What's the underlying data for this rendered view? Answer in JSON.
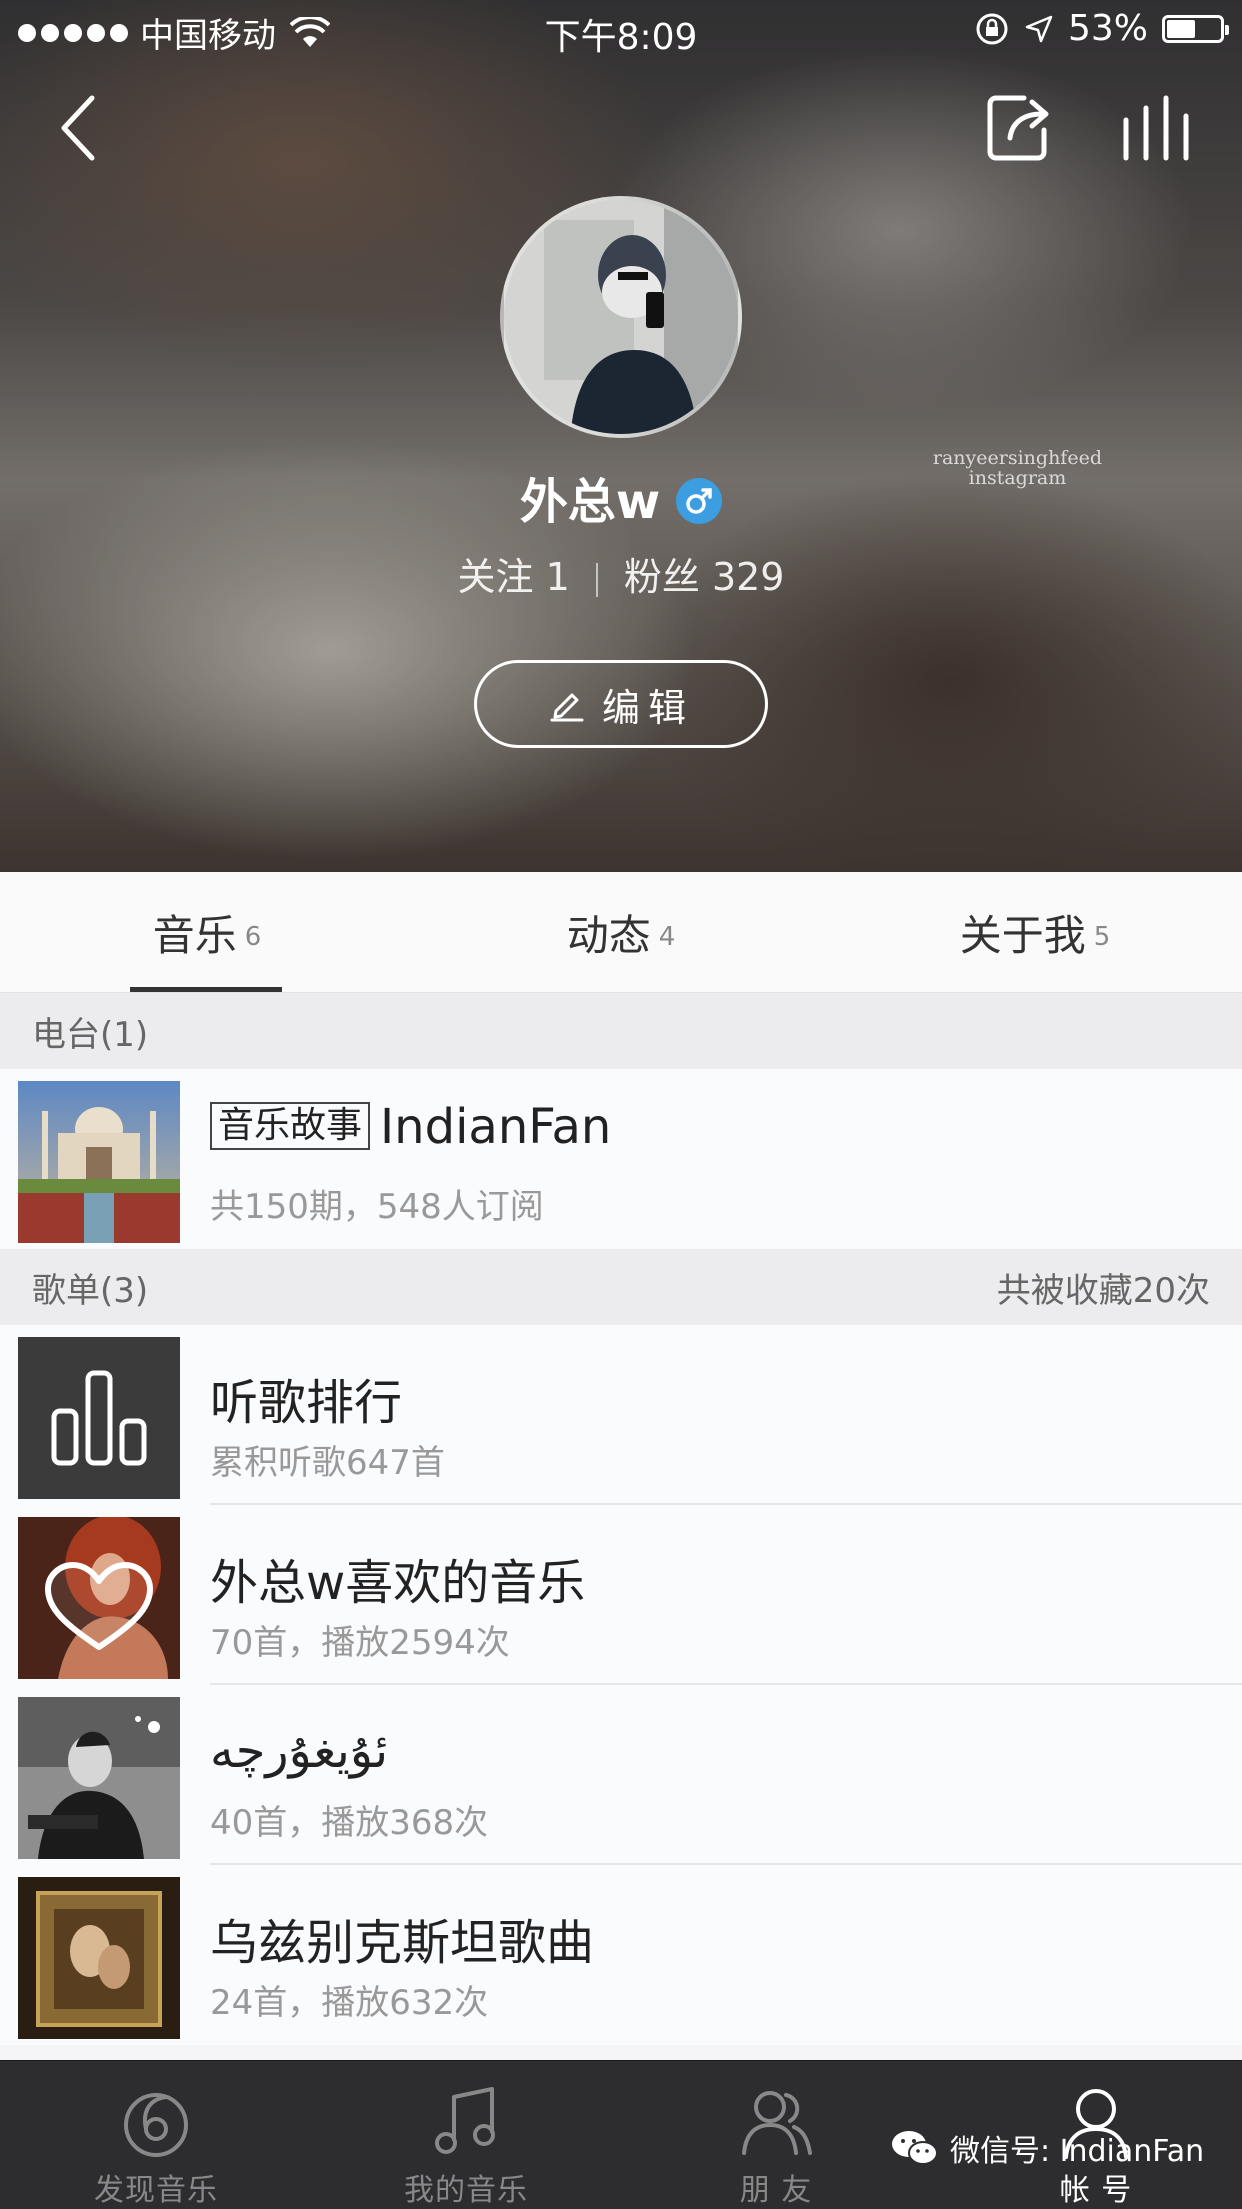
{
  "status_bar": {
    "carrier": "中国移动",
    "time": "下午8:09",
    "battery": "53%",
    "battery_level": 0.53
  },
  "cover": {
    "watermark_line1": "ranyeersinghfeed",
    "watermark_line2": "instagram"
  },
  "profile": {
    "name": "外总w",
    "gender_icon": "male-icon",
    "follow_label": "关注",
    "follow_count": "1",
    "fans_label": "粉丝",
    "fans_count": "329",
    "edit_label": "编辑"
  },
  "tabs": [
    {
      "label": "音乐",
      "count": "6",
      "active": true
    },
    {
      "label": "动态",
      "count": "4",
      "active": false
    },
    {
      "label": "关于我",
      "count": "5",
      "active": false
    }
  ],
  "radio": {
    "header": "电台(1)",
    "item": {
      "tag": "音乐故事",
      "title": "IndianFan",
      "subtitle": "共150期，548人订阅"
    }
  },
  "playlists": {
    "header": "歌单(3)",
    "header_right": "共被收藏20次",
    "items": [
      {
        "title": "听歌排行",
        "subtitle": "累积听歌647首"
      },
      {
        "title": "外总w喜欢的音乐",
        "subtitle": "70首，播放2594次"
      },
      {
        "title": "ئۇيغۇرچە",
        "subtitle": "40首，播放368次"
      },
      {
        "title": "乌兹别克斯坦歌曲",
        "subtitle": "24首，播放632次"
      }
    ]
  },
  "tabbar": {
    "items": [
      {
        "label": "发现音乐",
        "icon": "discover-music-icon"
      },
      {
        "label": "我的音乐",
        "icon": "music-note-icon"
      },
      {
        "label": "朋 友",
        "icon": "friends-icon"
      },
      {
        "label": "帐 号",
        "icon": "account-icon",
        "active": true
      }
    ],
    "watermark": "微信号: IndianFan"
  },
  "colors": {
    "gender_badge": "#3c9ee0",
    "tabbar_bg": "#2d2d2f",
    "section_header_bg": "#ececee"
  }
}
